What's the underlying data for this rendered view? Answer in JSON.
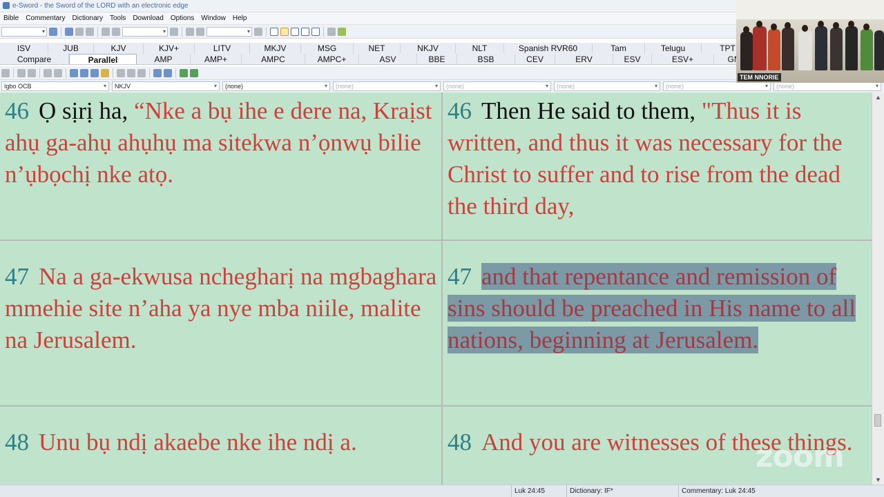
{
  "window": {
    "title": "e-Sword - the Sword of the LORD with an electronic edge"
  },
  "menu": [
    "Bible",
    "Commentary",
    "Dictionary",
    "Tools",
    "Download",
    "Options",
    "Window",
    "Help"
  ],
  "tabs": {
    "row1": [
      "ISV",
      "JUB",
      "KJV",
      "KJV+",
      "LITV",
      "MKJV",
      "MSG",
      "NET",
      "NKJV",
      "NLT",
      "Spanish RVR60",
      "Tam",
      "Telugu",
      "TPT"
    ],
    "row2": [
      "Compare",
      "Parallel",
      "AMP",
      "AMP+",
      "AMPC",
      "AMPC+",
      "ASV",
      "BBE",
      "BSB",
      "CEV",
      "ERV",
      "ESV",
      "ESV+",
      "GN"
    ],
    "active": "Parallel"
  },
  "selectors": [
    "Igbo OCB",
    "NKJV",
    "(none)",
    "(none)",
    "(none)",
    "(none)",
    "(none)",
    "(none)"
  ],
  "verses": [
    {
      "num": "46",
      "left_plain": "Ọ sịrị ha, ",
      "left_red": "“Nke a bụ ihe e dere na, Kraịst ahụ ga-ahụ ahụhụ ma sitekwa n’ọnwụ bilie n’ụbọchị nke atọ.",
      "right_plain": "Then He said to them, ",
      "right_red": "\"Thus it is written, and thus it was necessary for the Christ to suffer and to rise from the dead the third day,"
    },
    {
      "num": "47",
      "left_red": "Na a ga-ekwusa nchegharị na mgbaghara mmehie site n’aha ya nye mba niile, malite na Jerusalem.",
      "right_red": "and that repentance and remission of sins should be preached in His name to all nations, beginning at Jerusalem."
    },
    {
      "num": "48",
      "left_red": "Unu bụ ndị akaebe nke ihe ndị a.",
      "right_red": "And you are witnesses of these things."
    }
  ],
  "status": {
    "reference": "Luk 24:45",
    "dictionary": "Dictionary: IF*",
    "commentary": "Commentary: Luk 24:45"
  },
  "video": {
    "name": "TEM NNORIE"
  },
  "watermark": "zoom",
  "colors": {
    "background": "#c0e3cc",
    "text_red": "#c9423b",
    "verse_number": "#2f7f88",
    "highlight": "#7b9aa5"
  }
}
